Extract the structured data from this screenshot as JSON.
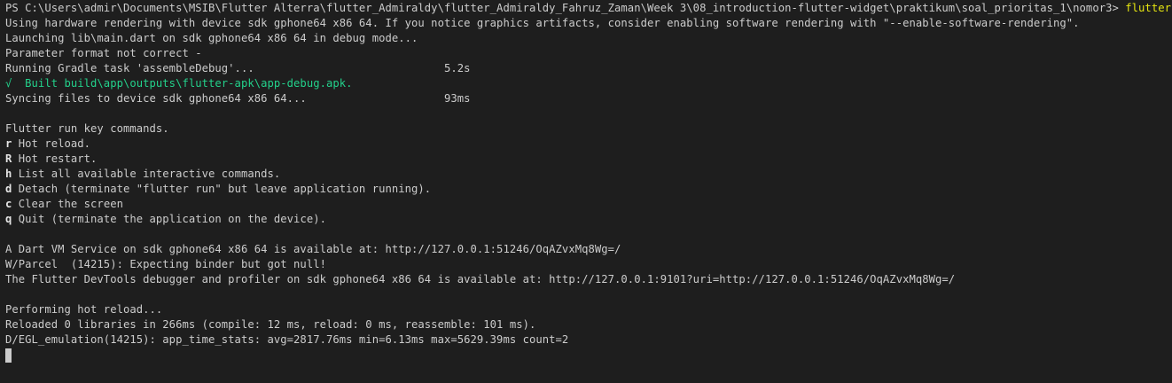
{
  "terminal": {
    "prompt": "PS C:\\Users\\admir\\Documents\\MSIB\\Flutter Alterra\\flutter_Admiraldy\\flutter_Admiraldy_Fahruz_Zaman\\Week 3\\08_introduction-flutter-widget\\praktikum\\soal_prioritas_1\\nomor3>",
    "command": "flutter run",
    "lines_top": [
      "Using hardware rendering with device sdk gphone64 x86 64. If you notice graphics artifacts, consider enabling software rendering with \"--enable-software-rendering\".",
      "Launching lib\\main.dart on sdk gphone64 x86 64 in debug mode...",
      "Parameter format not correct -",
      "Running Gradle task 'assembleDebug'...                             5.2s"
    ],
    "built_line": "√  Built build\\app\\outputs\\flutter-apk\\app-debug.apk.",
    "syncing_line": "Syncing files to device sdk gphone64 x86 64...                     93ms",
    "key_commands_title": "Flutter run key commands.",
    "key_commands": [
      {
        "key": "r",
        "desc": "Hot reload."
      },
      {
        "key": "R",
        "desc": "Hot restart."
      },
      {
        "key": "h",
        "desc": "List all available interactive commands."
      },
      {
        "key": "d",
        "desc": "Detach (terminate \"flutter run\" but leave application running)."
      },
      {
        "key": "c",
        "desc": "Clear the screen"
      },
      {
        "key": "q",
        "desc": "Quit (terminate the application on the device)."
      }
    ],
    "vm_service_lines": [
      "A Dart VM Service on sdk gphone64 x86 64 is available at: http://127.0.0.1:51246/OqAZvxMq8Wg=/",
      "W/Parcel  (14215): Expecting binder but got null!",
      "The Flutter DevTools debugger and profiler on sdk gphone64 x86 64 is available at: http://127.0.0.1:9101?uri=http://127.0.0.1:51246/OqAZvxMq8Wg=/"
    ],
    "reload_lines": [
      "Performing hot reload...",
      "Reloaded 0 libraries in 266ms (compile: 12 ms, reload: 0 ms, reassemble: 101 ms).",
      "D/EGL_emulation(14215): app_time_stats: avg=2817.76ms min=6.13ms max=5629.39ms count=2"
    ],
    "colors": {
      "background": "#1e1e1e",
      "text": "#cccccc",
      "command": "#e5e510",
      "success": "#23d18b"
    }
  }
}
